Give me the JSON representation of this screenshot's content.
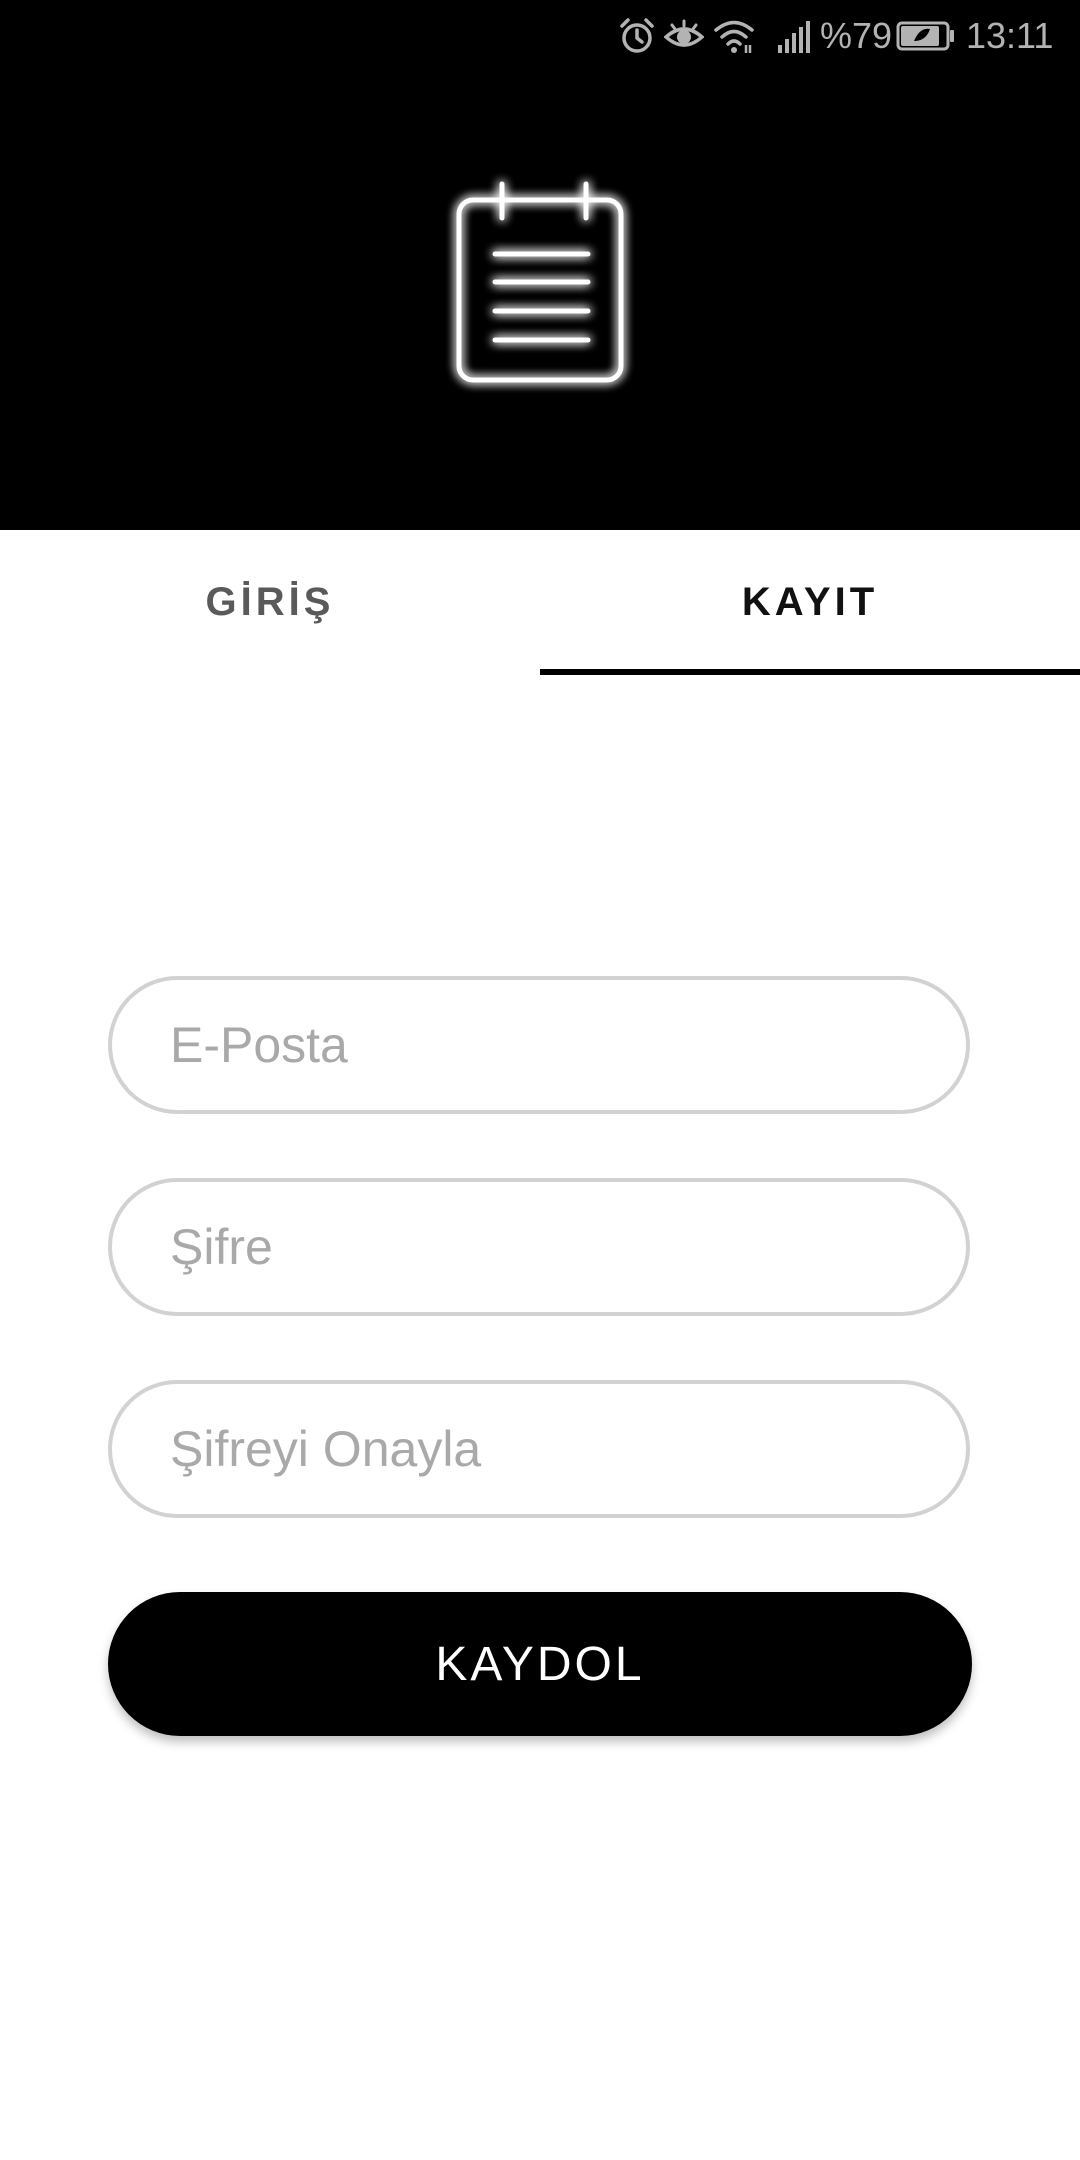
{
  "status_bar": {
    "icons": [
      "alarm-icon",
      "eye-icon",
      "wifi-icon",
      "signal-icon",
      "battery-icon"
    ],
    "battery_text": "%79",
    "time": "13:11"
  },
  "header": {
    "background": "#000000",
    "logo_icon": "notepad-icon"
  },
  "tabs": [
    {
      "label": "GİRİŞ",
      "active": false
    },
    {
      "label": "KAYIT",
      "active": true
    }
  ],
  "form": {
    "email": {
      "value": "",
      "placeholder": "E-Posta"
    },
    "password": {
      "value": "",
      "placeholder": "Şifre"
    },
    "confirm_password": {
      "value": "",
      "placeholder": "Şifreyi Onayla"
    },
    "submit_label": "KAYDOL"
  },
  "colors": {
    "accent": "#000000",
    "input_border": "#d2d2d2",
    "placeholder": "#a9a9a9"
  }
}
